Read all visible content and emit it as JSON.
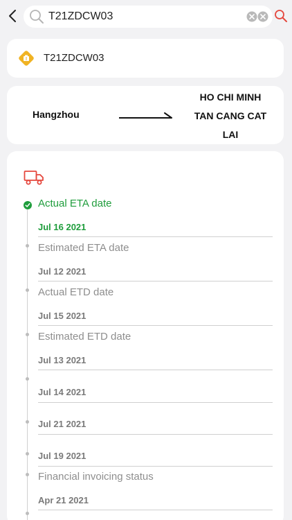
{
  "search": {
    "query": "T21ZDCW03"
  },
  "shipment": {
    "number": "T21ZDCW03"
  },
  "route": {
    "origin": "Hangzhou",
    "destination_lines": [
      "HO CHI MINH",
      "TAN CANG CAT",
      "LAI"
    ]
  },
  "colors": {
    "accent_green": "#1f9d3c",
    "accent_red": "#e5473d",
    "shipment_icon": "#f0b323"
  },
  "icons": {
    "back": "back-arrow-icon",
    "search": "search-icon",
    "clear": "clear-icon",
    "search_go": "search-go-icon",
    "shipment": "shipment-icon",
    "route": "route-arrow-icon",
    "truck": "truck-icon"
  },
  "timeline": [
    {
      "label": "Actual ETA date",
      "date": "Jul 16 2021",
      "active": true
    },
    {
      "label": "Estimated ETA date",
      "date": "Jul 12 2021",
      "active": false
    },
    {
      "label": "Actual ETD date",
      "date": "Jul 15 2021",
      "active": false
    },
    {
      "label": "Estimated ETD date",
      "date": "Jul 13 2021",
      "active": false
    },
    {
      "label": "",
      "date": "Jul 14 2021",
      "active": false
    },
    {
      "label": "",
      "date": "Jul 21 2021",
      "active": false
    },
    {
      "label": "",
      "date": "Jul 19 2021",
      "active": false
    },
    {
      "label": "Financial invoicing status",
      "date": "Apr 21 2021",
      "active": false
    }
  ]
}
